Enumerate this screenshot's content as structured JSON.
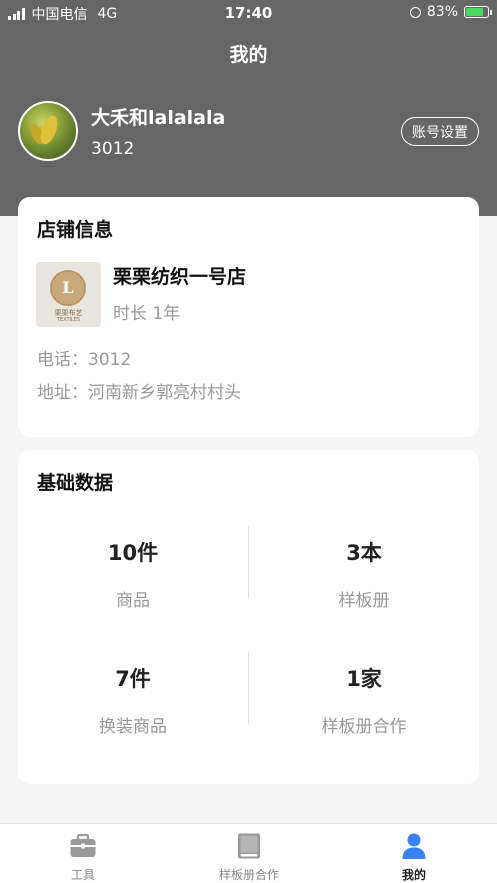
{
  "status_bar": {
    "carrier": "中国电信",
    "network": "4G",
    "time": "17:40",
    "battery": "83%",
    "battery_level": 0.83
  },
  "header": {
    "title": "我的",
    "user_name": "大禾和lalalala",
    "user_id": "3012",
    "account_button": "账号设置"
  },
  "store_info": {
    "section_title": "店铺信息",
    "logo_letter": "L",
    "logo_text": "栗栗布艺",
    "logo_subtext": "TEXTILES",
    "store_name": "栗栗纺织一号店",
    "duration": "时长 1年",
    "phone": "电话：3012",
    "address": "地址：河南新乡郭亮村村头"
  },
  "basic_data": {
    "section_title": "基础数据",
    "stats": [
      {
        "value": "10件",
        "label": "商品"
      },
      {
        "value": "3本",
        "label": "样板册"
      },
      {
        "value": "7件",
        "label": "换装商品"
      },
      {
        "value": "1家",
        "label": "样板册合作"
      }
    ]
  },
  "tab_bar": {
    "tabs": [
      {
        "label": "工具",
        "icon": "toolbox-icon",
        "active": false
      },
      {
        "label": "样板册合作",
        "icon": "book-icon",
        "active": false
      },
      {
        "label": "我的",
        "icon": "person-icon",
        "active": true
      }
    ]
  },
  "colors": {
    "header_bg": "#666666",
    "active_tab": "#3b82f6",
    "battery_fill": "#4cd964"
  }
}
